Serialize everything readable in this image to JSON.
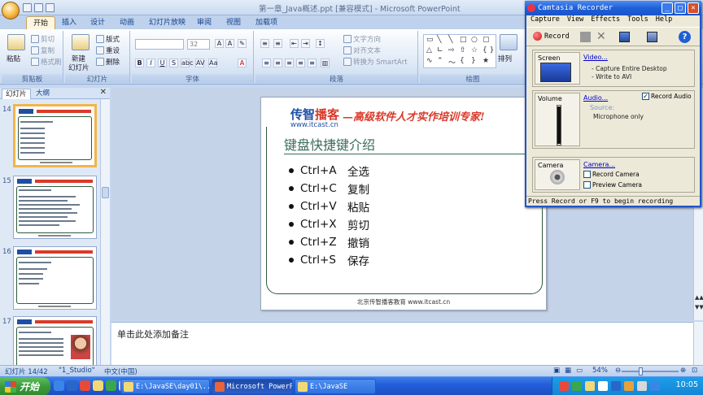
{
  "window": {
    "title": "第一章_Java概述.ppt [兼容模式] - Microsoft PowerPoint"
  },
  "ribbon": {
    "tabs": [
      "开始",
      "插入",
      "设计",
      "动画",
      "幻灯片放映",
      "审阅",
      "视图",
      "加载项"
    ],
    "clipboard": {
      "label": "剪贴板",
      "paste": "粘贴",
      "cut": "剪切",
      "copy": "复制",
      "format_painter": "格式刷"
    },
    "slides": {
      "label": "幻灯片",
      "new_slide": "新建",
      "new_slide2": "幻灯片",
      "layout": "版式",
      "reset": "重设",
      "delete": "删除"
    },
    "font": {
      "label": "字体",
      "size": "32"
    },
    "paragraph": {
      "label": "段落",
      "text_direction": "文字方向",
      "align_text": "对齐文本",
      "smartart": "转换为 SmartArt"
    },
    "drawing": {
      "label": "绘图",
      "arrange": "排列"
    }
  },
  "left_panel": {
    "tab_slides": "幻灯片",
    "tab_outline": "大纲",
    "thumbs": [
      {
        "num": "14",
        "active": true
      },
      {
        "num": "15",
        "active": false
      },
      {
        "num": "16",
        "active": false
      },
      {
        "num": "17",
        "active": false
      }
    ]
  },
  "slide": {
    "brand_a": "传智",
    "brand_b": "播客",
    "url": "www.itcast.cn",
    "slogan": "—高级软件人才实作培训专家!",
    "title": "键盘快捷键介绍",
    "shortcuts": [
      {
        "key": "Ctrl+A",
        "action": "全选"
      },
      {
        "key": "Ctrl+C",
        "action": "复制"
      },
      {
        "key": "Ctrl+V",
        "action": "粘贴"
      },
      {
        "key": "Ctrl+X",
        "action": "剪切"
      },
      {
        "key": "Ctrl+Z",
        "action": "撤销"
      },
      {
        "key": "Ctrl+S",
        "action": "保存"
      }
    ],
    "footer": "北京传智播客教育 www.itcast.cn"
  },
  "notes": {
    "placeholder": "单击此处添加备注"
  },
  "status": {
    "slide_count": "幻灯片 14/42",
    "theme": "\"1_Studio\"",
    "language": "中文(中国)",
    "zoom": "54%"
  },
  "taskbar": {
    "start": "开始",
    "tasks": [
      "E:\\JavaSE\\day01\\...",
      "Microsoft PowerP...",
      "E:\\JavaSE"
    ],
    "clock": "10:05"
  },
  "camtasia": {
    "title": "Camtasia Recorder",
    "menu": [
      "Capture",
      "View",
      "Effects",
      "Tools",
      "Help"
    ],
    "record": "Record",
    "screen": {
      "label": "Screen",
      "link": "Video...",
      "line1": "- Capture Entire Desktop",
      "line2": "- Write to AVI"
    },
    "volume": {
      "label": "Volume",
      "link": "Audio...",
      "record_audio": "Record Audio",
      "source_label": "Source:",
      "source": "Microphone only"
    },
    "camera": {
      "label": "Camera",
      "link": "Camera...",
      "record_camera": "Record Camera",
      "preview_camera": "Preview Camera"
    },
    "status": "Press Record or F9 to begin recording"
  },
  "colors": {
    "accent": "#1e4fa5",
    "slogan": "#d93a2a",
    "frame": "#2f5a3e"
  }
}
